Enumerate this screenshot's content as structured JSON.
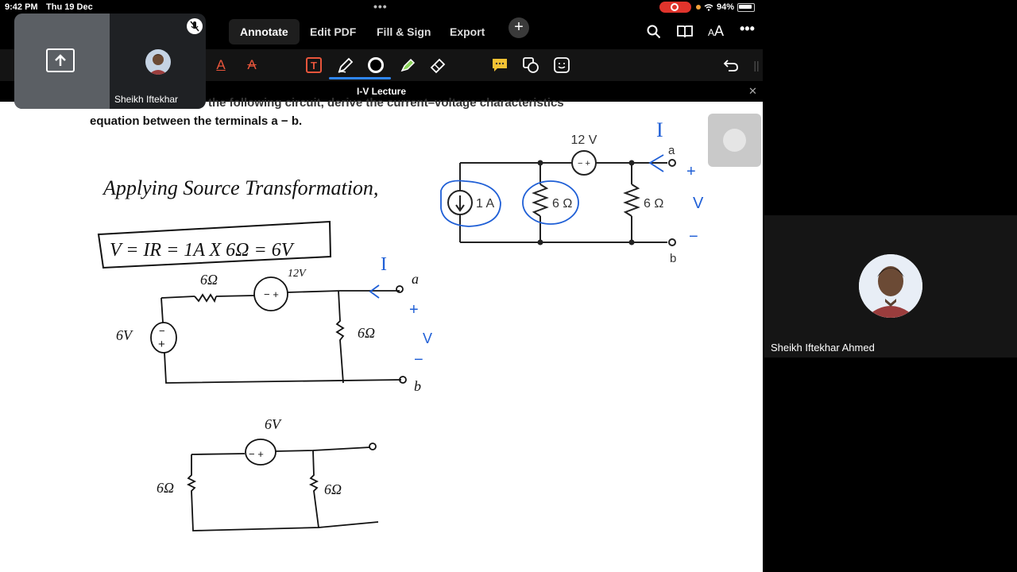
{
  "status_bar": {
    "time": "9:42 PM",
    "date": "Thu 19 Dec",
    "battery": "94%"
  },
  "app_tabs": [
    {
      "label": "Annotate",
      "active": true
    },
    {
      "label": "Edit PDF",
      "active": false
    },
    {
      "label": "Fill & Sign",
      "active": false
    },
    {
      "label": "Export",
      "active": false
    }
  ],
  "top_icons": {
    "search": "search-icon",
    "reader": "book-icon",
    "text_size": "AA",
    "more": "more-icon"
  },
  "toolbar_tools": [
    "text-color-icon",
    "strikethrough-icon",
    "text-box-icon",
    "pen-icon",
    "color-circle-icon",
    "highlighter-icon",
    "eraser-icon",
    "comment-icon",
    "shapes-icon",
    "sticker-icon",
    "undo-icon"
  ],
  "document": {
    "title": "I-V Lecture",
    "line1": "the following circuit, derive the current–voltage characteristics",
    "line2": "equation between the terminals a − b."
  },
  "circuit": {
    "source_voltage": "12 V",
    "current_source": "1 A",
    "r1": "6 Ω",
    "r2": "6 Ω",
    "terminal_a": "a",
    "terminal_b": "b"
  },
  "handwriting": {
    "heading": "Applying Source Transformation,",
    "equation": "V = IR = 1A X 6Ω = 6V",
    "current_label": "I",
    "plus": "+",
    "minus": "−",
    "v_label": "V",
    "c2_r1": "6Ω",
    "c2_src": "12V",
    "c2_left_src": "6V",
    "c2_r2": "6Ω",
    "c2_a": "a",
    "c2_b": "b",
    "c3_src": "6V",
    "c3_r1": "6Ω",
    "c3_r2": "6Ω"
  },
  "pip": {
    "name": "Sheikh Iftekhar"
  },
  "participant": {
    "name": "Sheikh Iftekhar Ahmed"
  },
  "colors": {
    "accent": "#2f86f5",
    "annotation_blue": "#1f5fd6",
    "recording": "#e0342c"
  }
}
